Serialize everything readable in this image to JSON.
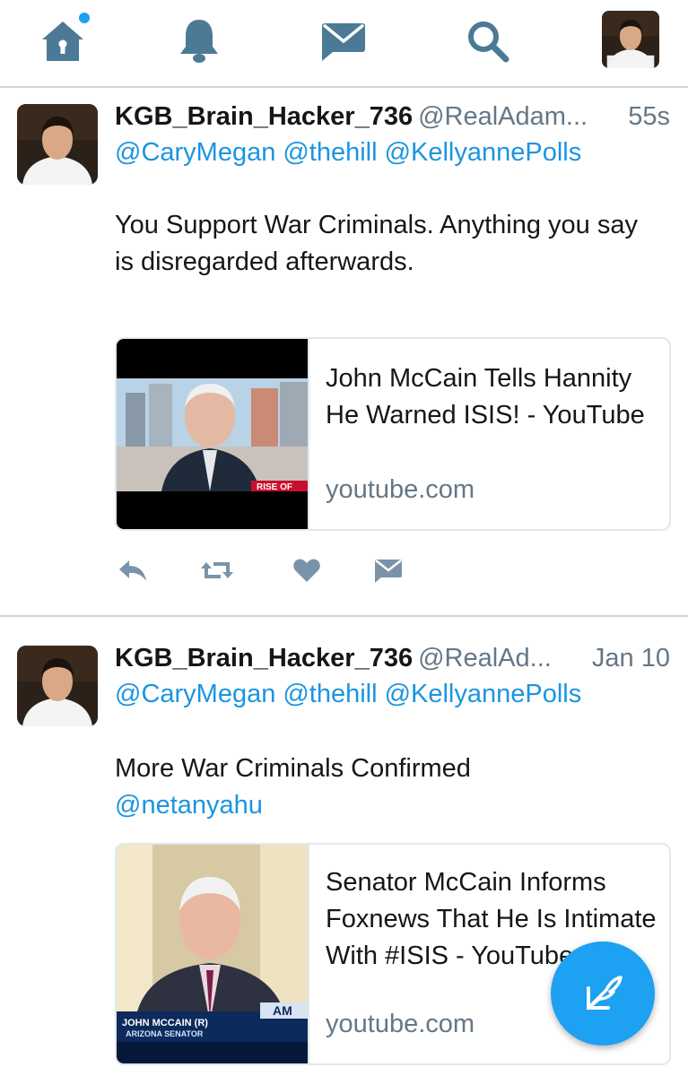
{
  "nav": {
    "items": [
      {
        "name": "home",
        "icon": "home-icon",
        "active": true,
        "has_notification_dot": true
      },
      {
        "name": "notifications",
        "icon": "bell-icon"
      },
      {
        "name": "messages",
        "icon": "envelope-icon"
      },
      {
        "name": "search",
        "icon": "search-icon"
      },
      {
        "name": "profile",
        "icon": "avatar"
      }
    ],
    "icon_color": "#4c7a96",
    "dot_color": "#1da1f2"
  },
  "tweets": [
    {
      "display_name": "KGB_Brain_Hacker_736",
      "handle": "@RealAdam...",
      "time": "55s",
      "mentions": [
        "@CaryMegan",
        "@thehill",
        "@KellyannePolls"
      ],
      "text": "You Support War Criminals. Anything you say is disregarded afterwards.",
      "link_text": "",
      "card": {
        "title": "John McCain Tells Hannity He Warned ISIS! - YouTube",
        "domain": "youtube.com",
        "thumb_caption": "RISE OF"
      }
    },
    {
      "display_name": "KGB_Brain_Hacker_736",
      "handle": "@RealAd...",
      "time": "Jan 10",
      "mentions": [
        "@CaryMegan",
        "@thehill",
        "@KellyannePolls"
      ],
      "text": "More War Criminals Confirmed",
      "link_text": "@netanyahu",
      "card": {
        "title": "Senator McCain Informs Foxnews That He Is Intimate With #ISIS - YouTube",
        "domain": "youtube.com",
        "thumb_caption": "JOHN MCCAIN (R)",
        "thumb_subcaption": "ARIZONA SENATOR",
        "thumb_tag": "AM"
      }
    }
  ],
  "actions": [
    "reply-icon",
    "retweet-icon",
    "like-icon",
    "direct-message-icon"
  ],
  "fab": {
    "icon": "compose-tweet-icon",
    "color": "#1da1f2"
  },
  "colors": {
    "link": "#1b95e0",
    "muted": "#657786",
    "border": "#e1e8ed"
  }
}
